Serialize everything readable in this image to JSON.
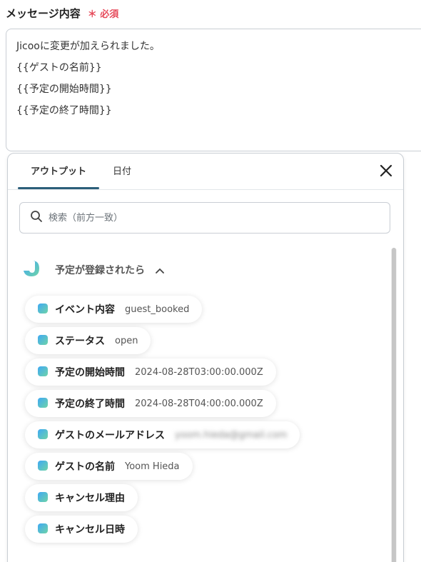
{
  "field": {
    "label": "メッセージ内容",
    "required": "＊ 必須"
  },
  "message": {
    "lines": [
      "Jicooに変更が加えられました。",
      "{{ゲストの名前}}",
      "{{予定の開始時間}}",
      "{{予定の終了時間}}"
    ]
  },
  "panel": {
    "tabs": [
      "アウトプット",
      "日付"
    ],
    "search_placeholder": "検索（前方一致）",
    "group_title": "予定が登録されたら",
    "items": [
      {
        "label": "イベント内容",
        "value": "guest_booked"
      },
      {
        "label": "ステータス",
        "value": "open"
      },
      {
        "label": "予定の開始時間",
        "value": "2024-08-28T03:00:00.000Z"
      },
      {
        "label": "予定の終了時間",
        "value": "2024-08-28T04:00:00.000Z"
      },
      {
        "label": "ゲストのメールアドレス",
        "value": "yoom.hieda@gmail.com"
      },
      {
        "label": "ゲストの名前",
        "value": "Yoom Hieda"
      },
      {
        "label": "キャンセル理由",
        "value": ""
      },
      {
        "label": "キャンセル日時",
        "value": ""
      }
    ]
  },
  "colors": {
    "required": "#e64a5a",
    "tab_indicator": "#2c5f7a",
    "icon_gradient": [
      "#3fa9f5",
      "#6fd3a8"
    ]
  }
}
